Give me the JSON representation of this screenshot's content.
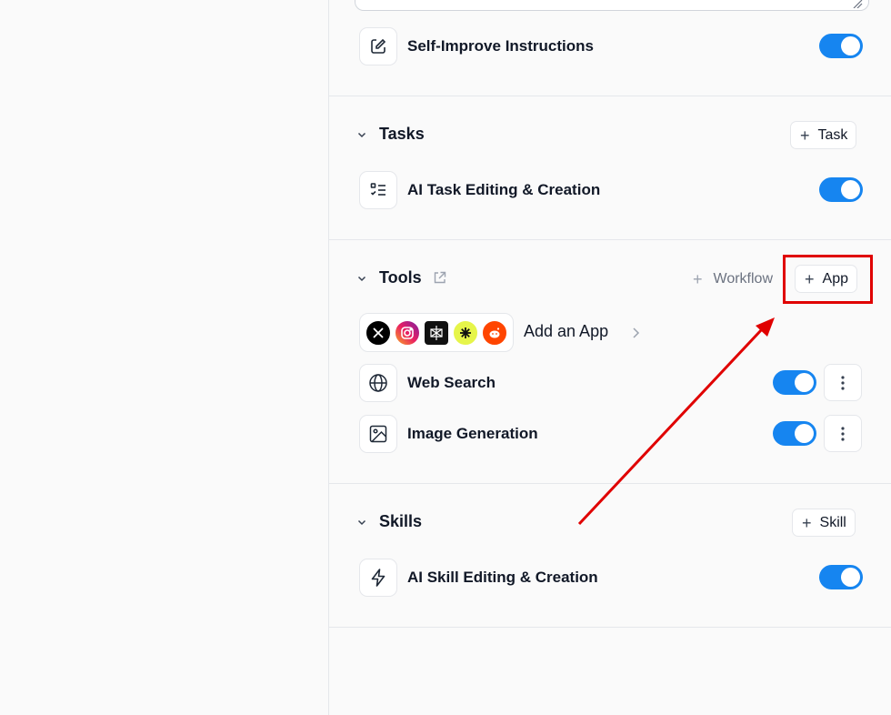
{
  "instructions": {
    "self_improve_label": "Self-Improve Instructions",
    "self_improve_enabled": true
  },
  "tasks": {
    "title": "Tasks",
    "add_label": "Task",
    "items": [
      {
        "label": "AI Task Editing & Creation",
        "enabled": true
      }
    ]
  },
  "tools": {
    "title": "Tools",
    "workflow_label": "Workflow",
    "add_app_button": "App",
    "add_an_app_label": "Add an App",
    "app_logos": [
      "x-logo-icon",
      "instagram-logo-icon",
      "perplexity-logo-icon",
      "yellow-app-logo-icon",
      "reddit-logo-icon"
    ],
    "items": [
      {
        "label": "Web Search",
        "enabled": true
      },
      {
        "label": "Image Generation",
        "enabled": true
      }
    ]
  },
  "skills": {
    "title": "Skills",
    "add_label": "Skill",
    "items": [
      {
        "label": "AI Skill Editing & Creation",
        "enabled": true
      }
    ]
  },
  "colors": {
    "toggle_on": "#1685f0",
    "annotation_red": "#e00000"
  }
}
